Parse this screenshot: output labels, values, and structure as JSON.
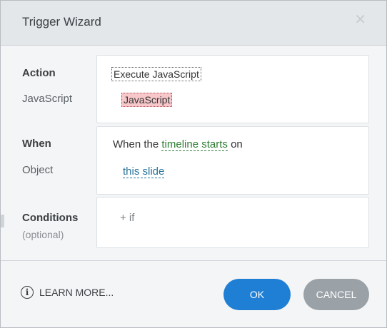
{
  "dialog": {
    "title": "Trigger Wizard",
    "close_icon": "close-icon"
  },
  "action_section": {
    "action_label": "Action",
    "action_value": "Execute JavaScript",
    "javascript_label": "JavaScript",
    "javascript_value": "JavaScript"
  },
  "when_section": {
    "when_label": "When",
    "when_prefix": "When the",
    "timeline_link": "timeline starts",
    "when_suffix": "on",
    "object_label": "Object",
    "object_value": "this slide"
  },
  "conditions_section": {
    "label": "Conditions",
    "sublabel": "(optional)",
    "add_if": "+ if"
  },
  "footer": {
    "learn_more": "LEARN MORE...",
    "ok": "OK",
    "cancel": "CANCEL"
  },
  "colors": {
    "ok_bg": "#1f7fd4",
    "cancel_bg": "#9aa2a8",
    "timeline_link": "#2e7d32",
    "object_link": "#26739b",
    "js_highlight": "#f7c7ca"
  }
}
